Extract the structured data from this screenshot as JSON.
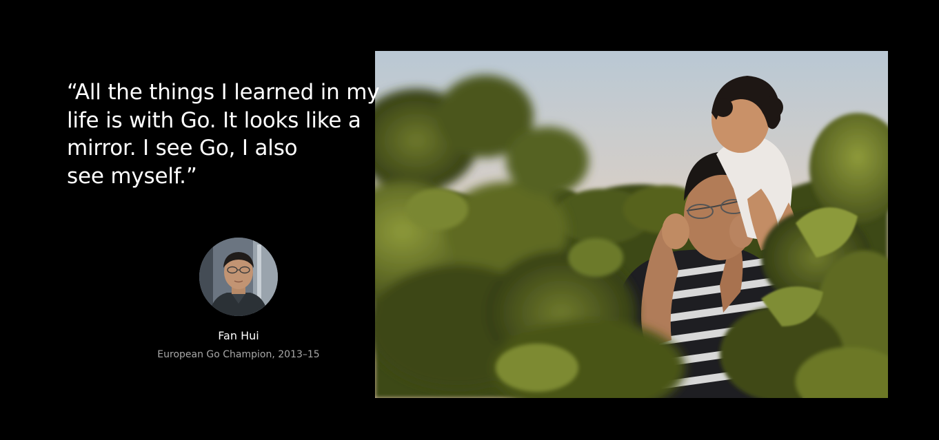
{
  "testimonial": {
    "quote_lines": [
      "“All the things I learned in my",
      "life is with Go. It looks like a",
      "mirror. I see Go, I also",
      "see myself.”"
    ],
    "person_name": "Fan Hui",
    "person_title": "European Go Champion, 2013–15"
  },
  "media": {
    "photo_subject": "father-carrying-child-in-vineyard",
    "avatar_subject": "portrait-of-fan-hui"
  },
  "colors": {
    "background": "#000000",
    "text_primary": "#ffffff",
    "text_secondary": "#a8a8a8"
  }
}
